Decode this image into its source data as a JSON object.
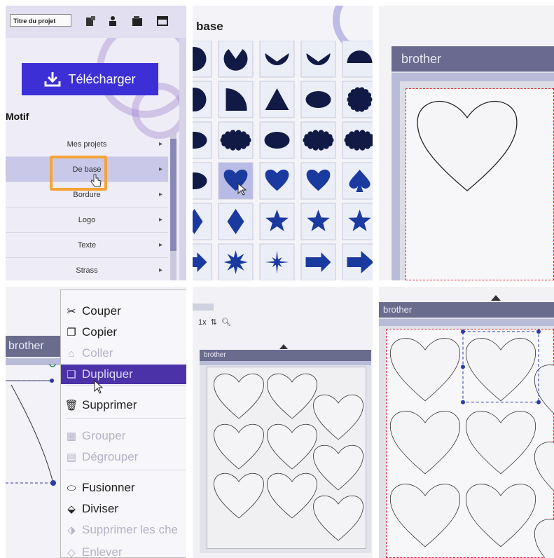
{
  "panel1": {
    "project_title": "Titre du projet",
    "download_button": "Télécharger",
    "section_title": "Motif",
    "menu": [
      {
        "label": "Mes projets",
        "selected": false
      },
      {
        "label": "De base",
        "selected": true
      },
      {
        "label": "Bordure",
        "selected": false
      },
      {
        "label": "Logo",
        "selected": false
      },
      {
        "label": "Texte",
        "selected": false
      },
      {
        "label": "Strass",
        "selected": false
      }
    ],
    "toolbar_icons": [
      "new-project-icon",
      "user-icon",
      "folder-icon",
      "window-icon"
    ],
    "accent_color": "#3c2fd6",
    "highlight_color": "#f5a337"
  },
  "panel2": {
    "category_title": "base",
    "shapes": [
      [
        "circle",
        "pacman",
        "pacman-half",
        "pacman-half",
        "half-circle"
      ],
      [
        "circle-partial",
        "quarter-circle",
        "triangle",
        "ellipse",
        "scalloped-circle"
      ],
      [
        "ellipse-partial",
        "scalloped-ellipse",
        "ellipse",
        "scalloped-ellipse-wide",
        "scalloped-ellipse"
      ],
      [
        "ellipse-partial",
        "heart",
        "heart",
        "heart",
        "spade"
      ],
      [
        "diamond-partial",
        "diamond",
        "star",
        "star",
        "star"
      ],
      [
        "arrow-partial",
        "starburst-8",
        "starburst-sparkle",
        "arrow-right",
        "arrow-right-chevron"
      ]
    ],
    "selected_shape": "heart",
    "shape_color": "#1a3aa0"
  },
  "panel3": {
    "brand": "brother"
  },
  "panel4": {
    "brand": "brother",
    "context_menu": [
      {
        "label": "Couper",
        "icon": "scissors-icon",
        "disabled": false,
        "highlighted": false
      },
      {
        "label": "Copier",
        "icon": "copy-icon",
        "disabled": false,
        "highlighted": false
      },
      {
        "label": "Coller",
        "icon": "paste-icon",
        "disabled": true,
        "highlighted": false
      },
      {
        "label": "Dupliquer",
        "icon": "duplicate-icon",
        "disabled": false,
        "highlighted": true
      },
      {
        "label": "Supprimer",
        "icon": "trash-icon",
        "disabled": false,
        "highlighted": false
      },
      {
        "label": "Grouper",
        "icon": "group-icon",
        "disabled": true,
        "highlighted": false
      },
      {
        "label": "Dégrouper",
        "icon": "ungroup-icon",
        "disabled": true,
        "highlighted": false
      },
      {
        "label": "Fusionner",
        "icon": "merge-icon",
        "disabled": false,
        "highlighted": false
      },
      {
        "label": "Diviser",
        "icon": "divide-icon",
        "disabled": false,
        "highlighted": false
      },
      {
        "label": "Supprimer les che",
        "icon": "remove-path-icon",
        "disabled": true,
        "highlighted": false
      },
      {
        "label": "Enlever",
        "icon": "remove-icon",
        "disabled": true,
        "highlighted": false
      }
    ]
  },
  "panel5": {
    "brand": "brother",
    "zoom_value": "1x",
    "heart_count": 9
  },
  "panel6": {
    "brand": "brother",
    "heart_count": 9
  }
}
